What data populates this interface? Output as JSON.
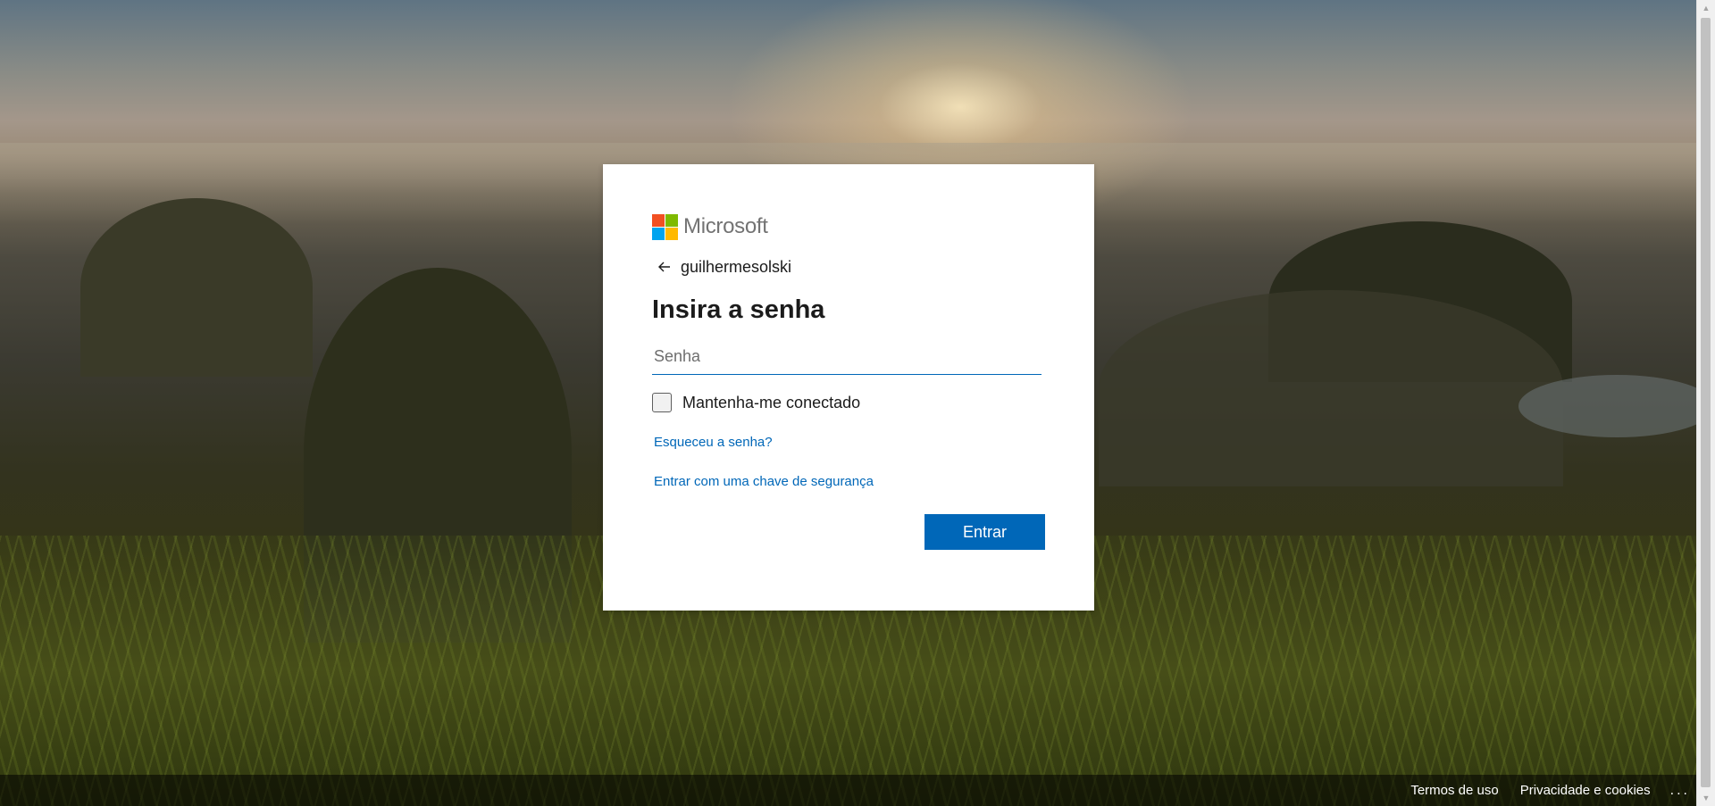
{
  "brand": {
    "name": "Microsoft",
    "logo_colors": [
      "#f25022",
      "#7fba00",
      "#00a4ef",
      "#ffb900"
    ]
  },
  "signin": {
    "back_icon": "arrow-left-icon",
    "username": "guilhermesolski",
    "title": "Insira a senha",
    "password_placeholder": "Senha",
    "password_value": "",
    "keep_signed_in_label": "Mantenha-me conectado",
    "keep_signed_in_checked": false,
    "forgot_password_link": "Esqueceu a senha?",
    "security_key_link": "Entrar com uma chave de segurança",
    "submit_label": "Entrar",
    "accent_color": "#0067b8"
  },
  "footer": {
    "terms_label": "Termos de uso",
    "privacy_label": "Privacidade e cookies",
    "more_label": "..."
  }
}
